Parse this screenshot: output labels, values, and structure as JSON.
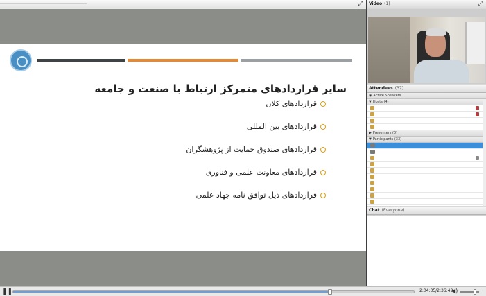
{
  "slide": {
    "title": "سایر قراردادهای متمرکز ارتباط با صنعت و جامعه",
    "bullets": [
      "قراردادهای کلان",
      "قراردادهای بین المللی",
      "قراردادهای صندوق حمایت از پژوهشگران",
      "قراردادهای معاونت علمی و فناوری",
      "قراردادهای ذیل توافق نامه جهاد علمی"
    ],
    "colors": {
      "bar_dark": "#3e4446",
      "bar_orange": "#e9872c",
      "bar_gray": "#9aa0a3",
      "bullet": "#d4a017"
    }
  },
  "video_pod": {
    "title": "Video",
    "count": "(1)"
  },
  "attendees_pod": {
    "title": "Attendees",
    "count": "(37)",
    "active_speakers": "Active Speakers",
    "sections": {
      "hosts": {
        "label": "Hosts",
        "count": "(4)"
      },
      "presenters": {
        "label": "Presenters",
        "count": "(0)"
      },
      "participants": {
        "label": "Participants",
        "count": "(33)"
      }
    }
  },
  "chat_pod": {
    "title": "Chat",
    "scope": "(Everyone)"
  },
  "playback": {
    "time": "2:04:35/2:36:43",
    "progress": 0.79,
    "volume": 0.8
  }
}
